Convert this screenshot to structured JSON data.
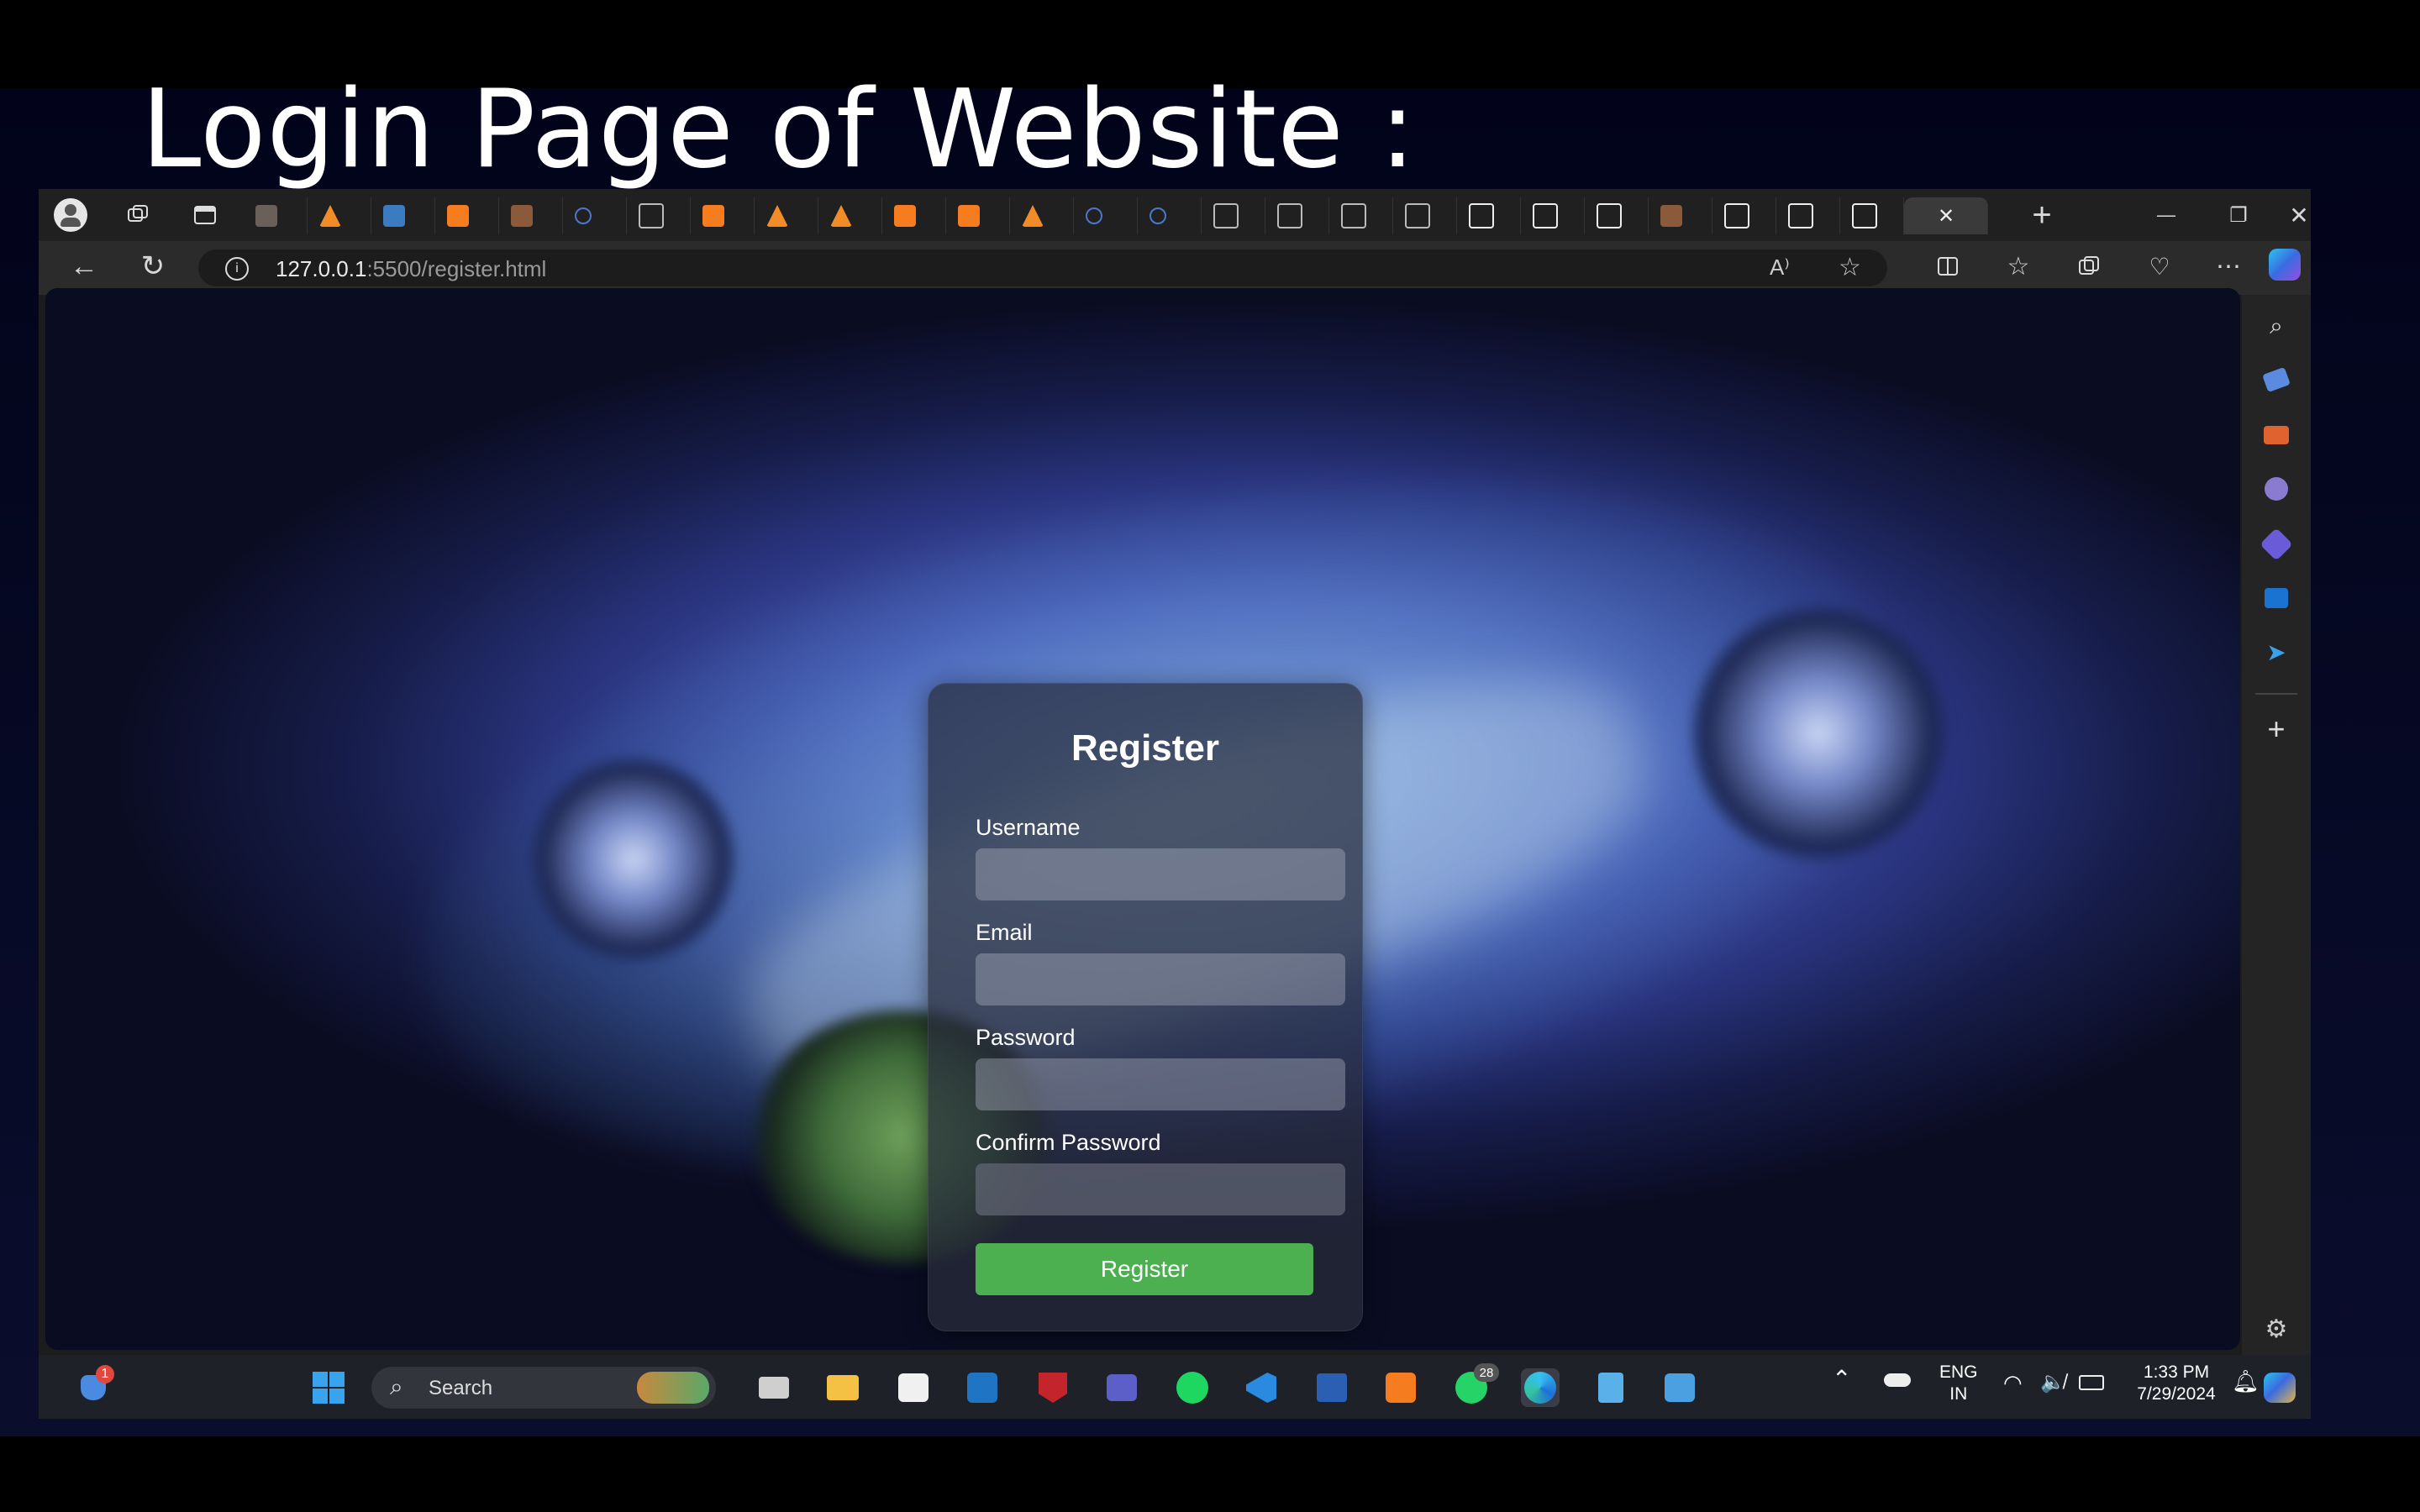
{
  "slide": {
    "title": "Login Page of Website :"
  },
  "browser": {
    "url_host": "127.0.0.1",
    "url_path": ":5500/register.html",
    "tab_close": "✕",
    "new_tab": "+",
    "min": "—",
    "restore": "❐",
    "close": "✕"
  },
  "form": {
    "title": "Register",
    "username_label": "Username",
    "email_label": "Email",
    "password_label": "Password",
    "confirm_label": "Confirm Password",
    "submit_label": "Register"
  },
  "taskbar": {
    "search_label": "Search",
    "notification_count": "1",
    "whatsapp_count": "28",
    "lang_top": "ENG",
    "lang_bottom": "IN",
    "time": "1:33 PM",
    "date": "7/29/2024"
  },
  "colors": {
    "accent_green": "#4caf50",
    "edge_blue": "#3b82f6"
  }
}
